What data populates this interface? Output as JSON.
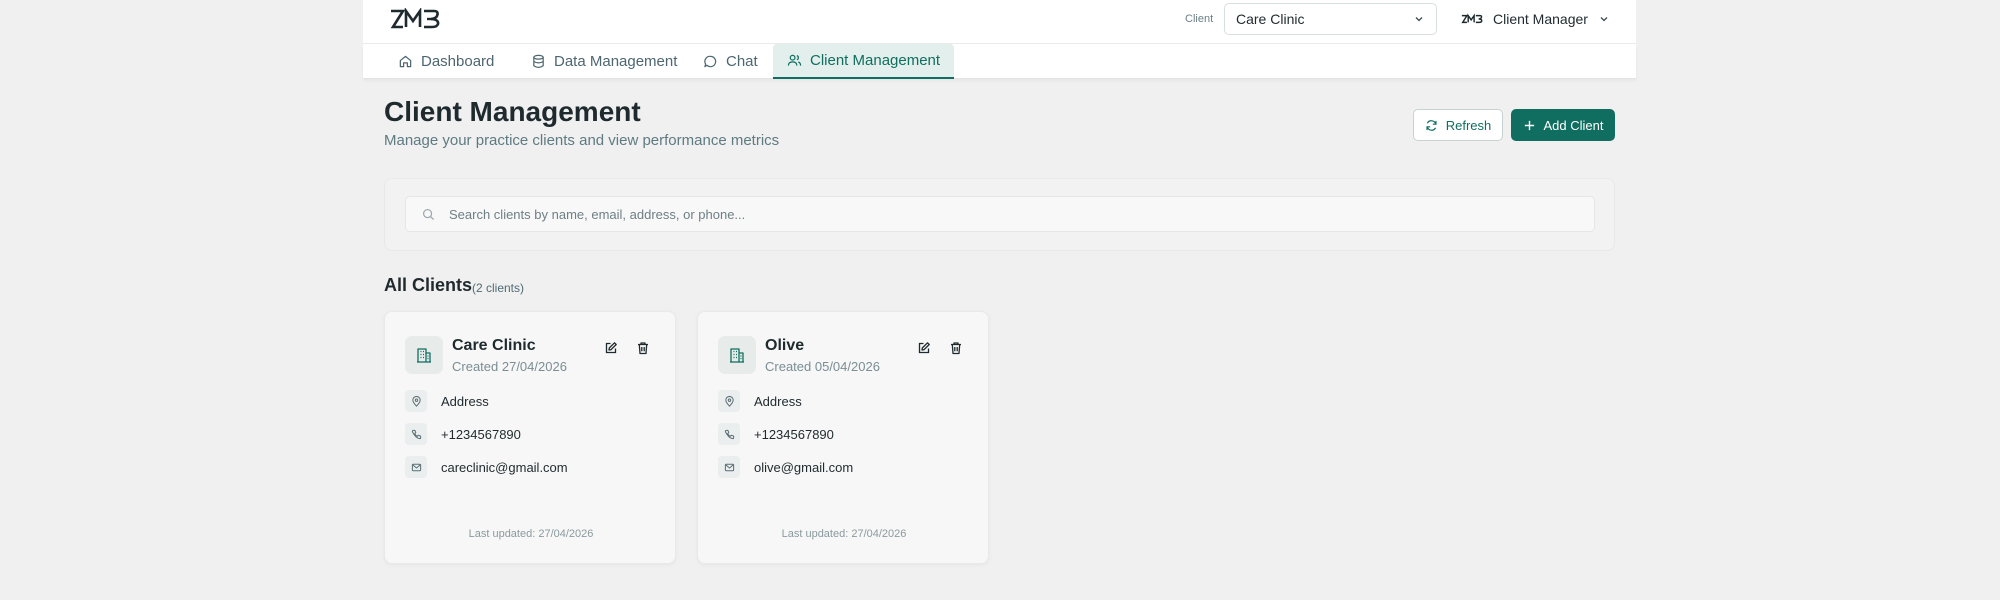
{
  "header": {
    "client_label": "Client",
    "client_select": {
      "value": "Care Clinic"
    },
    "user_menu": {
      "label": "Client Manager"
    }
  },
  "nav": {
    "tabs": [
      {
        "label": "Dashboard",
        "icon": "home-icon"
      },
      {
        "label": "Data Management",
        "icon": "database-icon"
      },
      {
        "label": "Chat",
        "icon": "chat-icon"
      },
      {
        "label": "Client Management",
        "icon": "users-icon",
        "active": true
      }
    ]
  },
  "page": {
    "title": "Client Management",
    "subtitle": "Manage your practice clients and view performance metrics",
    "refresh_label": "Refresh",
    "add_label": "Add Client"
  },
  "search": {
    "placeholder": "Search clients by name, email, address, or phone..."
  },
  "list": {
    "title": "All Clients",
    "count": "(2 clients)"
  },
  "clients": [
    {
      "name": "Care Clinic",
      "created": "Created 27/04/2026",
      "address": "Address",
      "phone": "+1234567890",
      "email": "careclinic@gmail.com",
      "updated": "Last updated: 27/04/2026"
    },
    {
      "name": "Olive",
      "created": "Created 05/04/2026",
      "address": "Address",
      "phone": "+1234567890",
      "email": "olive@gmail.com",
      "updated": "Last updated: 27/04/2026"
    }
  ],
  "colors": {
    "accent": "#0f6e5f",
    "background": "#f0f0f0",
    "active_tab_bg": "#e3efec"
  }
}
